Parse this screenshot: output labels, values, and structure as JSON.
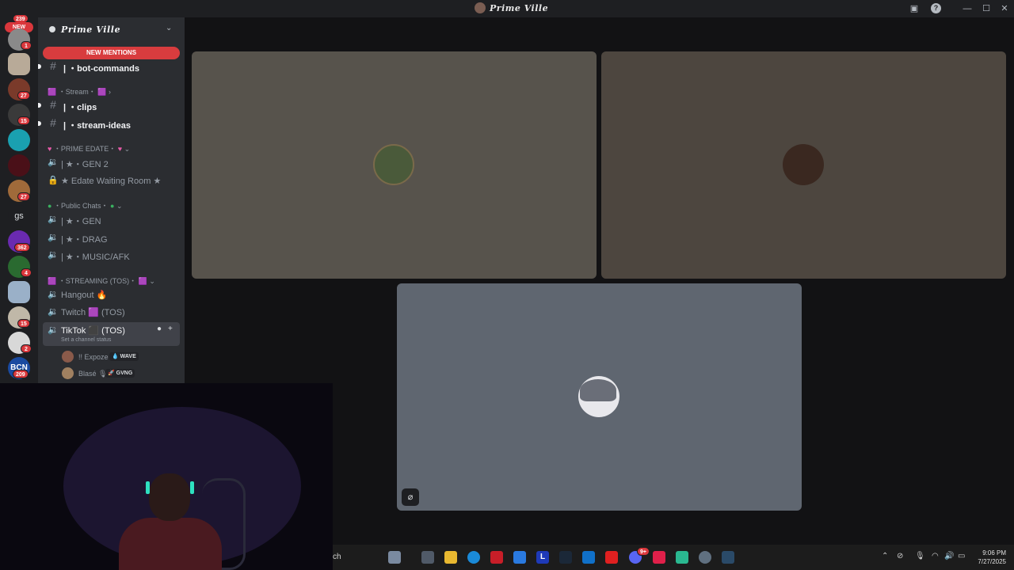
{
  "window": {
    "title": "Prime Ville",
    "controls": [
      "minimize",
      "maximize",
      "close"
    ]
  },
  "server_rail": {
    "new_label": "NEW",
    "top_count": "239",
    "servers": [
      {
        "badge": "1"
      },
      {
        "badge": ""
      },
      {
        "badge": "27"
      },
      {
        "badge": "15"
      },
      {
        "badge": ""
      },
      {
        "badge": ""
      },
      {
        "badge": "27"
      },
      {
        "initials": "gs",
        "badge": ""
      },
      {
        "badge": "362"
      },
      {
        "badge": "4"
      },
      {
        "badge": ""
      },
      {
        "badge": "15"
      },
      {
        "badge": "2"
      },
      {
        "initials": "BCN",
        "badge": "209"
      }
    ]
  },
  "sidebar": {
    "server_name": "Prime Ville",
    "new_mentions": "NEW MENTIONS",
    "channels_top": [
      {
        "label": "| ・bot-commands",
        "unread": true
      }
    ],
    "categories": {
      "stream": "・Stream・",
      "prime_edate": "・PRIME EDATE・",
      "public_chats": "・Public Chats・",
      "streaming": "・STREAMING (TOS)・"
    },
    "stream_channels": [
      {
        "label": "| ・clips"
      },
      {
        "label": "| ・stream-ideas"
      }
    ],
    "edate_channels": [
      {
        "label": "| ★・GEN 2"
      },
      {
        "label": "★ Edate Waiting Room ★"
      }
    ],
    "public_channels": [
      {
        "label": "| ★・GEN"
      },
      {
        "label": "| ★・DRAG"
      },
      {
        "label": "| ★・MUSIC/AFK"
      }
    ],
    "streaming_channels": [
      {
        "label": "Hangout 🔥"
      },
      {
        "label": "Twitch 🟪 (TOS)"
      },
      {
        "label": "TikTok ⬛ (TOS)",
        "status": "Set a channel status"
      }
    ],
    "voice_users": [
      {
        "name": "!! Expoze",
        "tag": "💧 WAVE"
      },
      {
        "name": "Blasé 🎙",
        "tag": "🚀 GVNG"
      }
    ]
  },
  "stage": {
    "tiles": [
      {
        "color": "#57534c"
      },
      {
        "color": "#4d463f"
      },
      {
        "color": "#5f6670"
      }
    ]
  },
  "taskbar": {
    "search_fragment": "ch",
    "apps": [
      "widgets",
      "task-view",
      "file-explorer",
      "edge",
      "mcafee",
      "vscode",
      "lightshot",
      "steam",
      "outlook",
      "youtube",
      "discord",
      "tiktok",
      "app",
      "settings",
      "steam-2"
    ],
    "discord_badge": "9+",
    "time": "9:06 PM",
    "date": "7/27/2025"
  }
}
